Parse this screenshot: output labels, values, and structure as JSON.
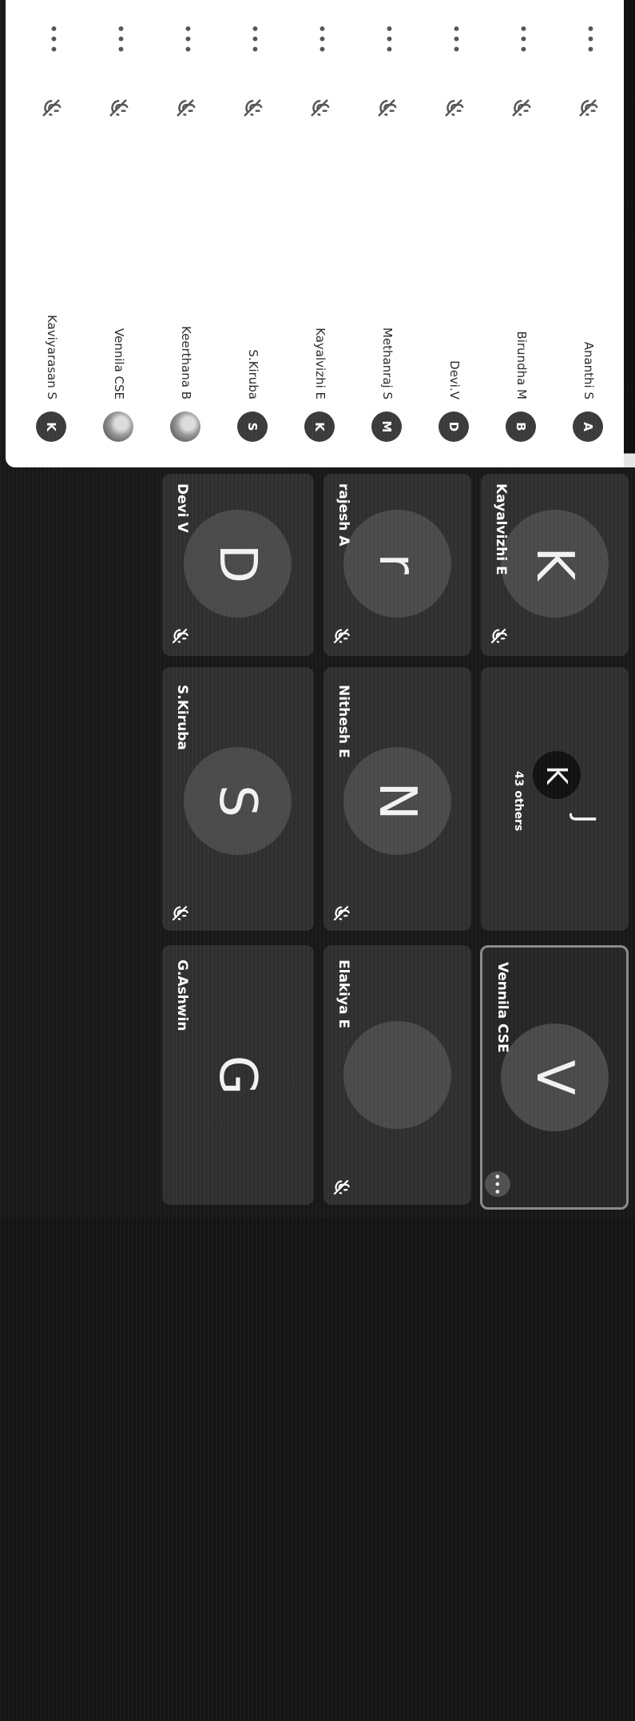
{
  "participants_panel": {
    "participants": [
      {
        "initial": "A",
        "name": "Ananthi S",
        "photo": false
      },
      {
        "initial": "B",
        "name": "Birundha M",
        "photo": false
      },
      {
        "initial": "D",
        "name": "Devi.V",
        "photo": false
      },
      {
        "initial": "M",
        "name": "Methanraj S",
        "photo": false
      },
      {
        "initial": "K",
        "name": "Kayalvizhi E",
        "photo": false
      },
      {
        "initial": "S",
        "name": "S.Kiruba",
        "photo": false
      },
      {
        "initial": "",
        "name": "Keerthana B",
        "photo": true
      },
      {
        "initial": "",
        "name": "Vennila CSE",
        "photo": true
      },
      {
        "initial": "K",
        "name": "Kaviyarasan S",
        "photo": false
      }
    ],
    "more_icon": "more-horizontal-icon",
    "mic_icon": "mic-off-icon"
  },
  "tiles": {
    "kayalvizhi": {
      "name": "Kayalvizhi E",
      "initial": "K"
    },
    "rajesh": {
      "name": "rajesh A",
      "initial": "r"
    },
    "devi": {
      "name": "Devi V",
      "initial": "D"
    },
    "others": {
      "label": "43 others",
      "initial_1": "K",
      "initial_2": "J"
    },
    "nithesh": {
      "name": "Nithesh E",
      "initial": "N"
    },
    "kiruba": {
      "name": "S.Kiruba",
      "initial": "S"
    },
    "vennila": {
      "name": "Vennila CSE",
      "initial": "V",
      "more": "•••"
    },
    "elakiya": {
      "name": "Elakiya E"
    },
    "ashwin": {
      "name": "G.Ashwin",
      "initial": "G"
    }
  },
  "colors": {
    "background": "#181818",
    "tile": "#2f2f2f",
    "avatar_circle": "#4a4a4a",
    "panel": "#ffffff"
  }
}
